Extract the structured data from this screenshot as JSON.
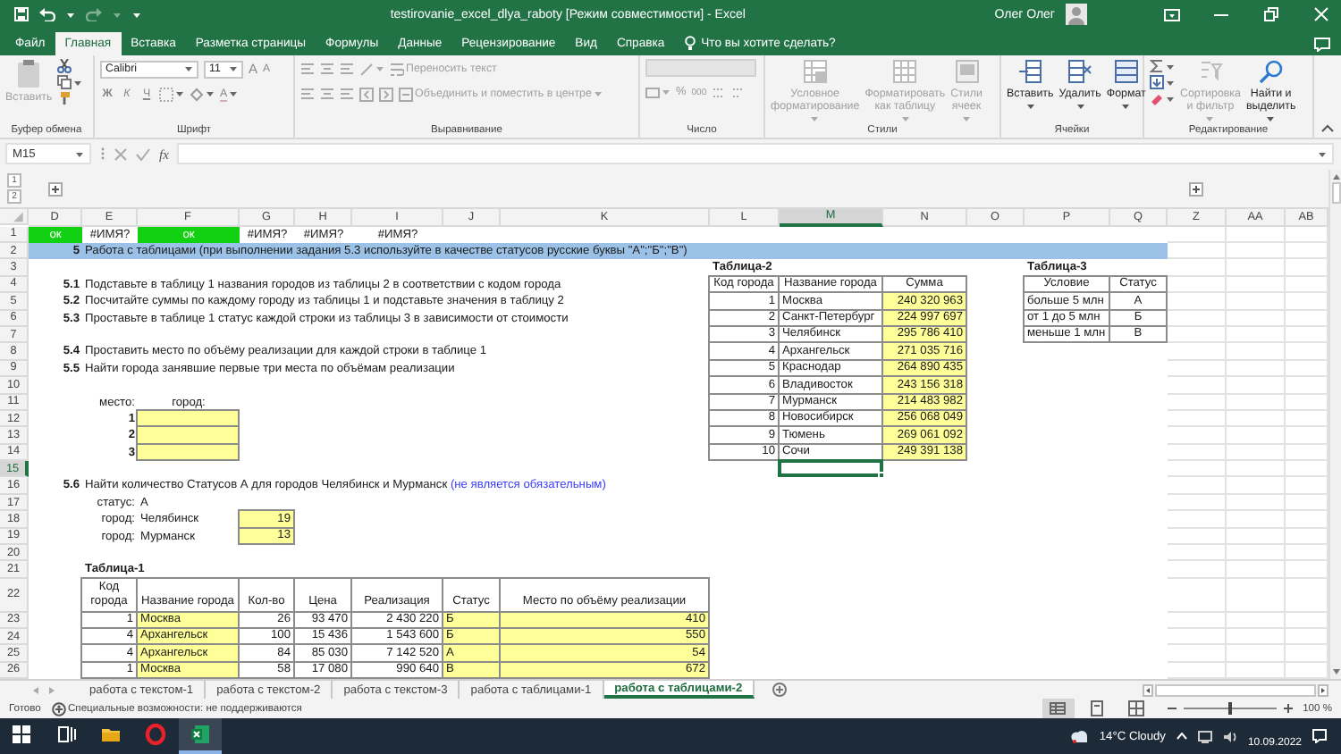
{
  "window": {
    "title": "testirovanie_excel_dlya_raboty [Режим совместимости] - Excel",
    "user": "Олег Олег",
    "quick_access": [
      {
        "kind": "save",
        "disabled": false
      },
      {
        "kind": "undo",
        "disabled": false
      },
      {
        "kind": "redo",
        "disabled": true
      }
    ]
  },
  "menu_tabs": [
    {
      "label": "Файл",
      "selected": false
    },
    {
      "label": "Главная",
      "selected": true
    },
    {
      "label": "Вставка",
      "selected": false
    },
    {
      "label": "Разметка страницы",
      "selected": false
    },
    {
      "label": "Формулы",
      "selected": false
    },
    {
      "label": "Данные",
      "selected": false
    },
    {
      "label": "Рецензирование",
      "selected": false
    },
    {
      "label": "Вид",
      "selected": false
    },
    {
      "label": "Справка",
      "selected": false
    }
  ],
  "tell_me": {
    "placeholder": "Что вы хотите сделать?"
  },
  "ribbon": {
    "clipboard": {
      "label": "Буфер обмена",
      "paste": "Вставить",
      "disabled": true
    },
    "font": {
      "label": "Шрифт",
      "name": "Calibri",
      "size": "11",
      "size_buttons": [
        "A",
        "A"
      ],
      "styles": [
        "Ж",
        "К",
        "Ч"
      ],
      "color_button": "A"
    },
    "alignment": {
      "label": "Выравнивание",
      "buttons": [
        {
          "label": "Переносить текст",
          "disabled": true
        },
        {
          "label": "Объединить и поместить в центре",
          "disabled": true
        }
      ]
    },
    "number": {
      "label": "Число",
      "symbols": [
        "%",
        "000"
      ]
    },
    "styles": {
      "label": "Стили",
      "buttons": [
        {
          "label": "Условное\nформатирование",
          "disabled": true
        },
        {
          "label": "Форматировать\nкак таблицу",
          "disabled": true
        },
        {
          "label": "Стили\nячеек",
          "disabled": true
        }
      ]
    },
    "cells": {
      "label": "Ячейки",
      "buttons": [
        {
          "label": "Вставить",
          "disabled": false
        },
        {
          "label": "Удалить",
          "disabled": false
        },
        {
          "label": "Формат",
          "disabled": false
        }
      ]
    },
    "editing": {
      "label": "Редактирование",
      "buttons": [
        {
          "label": "Сортировка\nи фильтр",
          "disabled": true
        },
        {
          "label": "Найти и\nвыделить",
          "disabled": false
        }
      ]
    }
  },
  "formula_bar": {
    "name_box": "M15",
    "function_label": "fx"
  },
  "outline": {
    "levels": [
      "1",
      "2"
    ],
    "groups": [
      {
        "expanded": false
      },
      {
        "expanded": false
      }
    ]
  },
  "sheet": {
    "columns": [
      {
        "label": "D",
        "selected": false
      },
      {
        "label": "E",
        "selected": false
      },
      {
        "label": "F",
        "selected": false
      },
      {
        "label": "G",
        "selected": false
      },
      {
        "label": "H",
        "selected": false
      },
      {
        "label": "I",
        "selected": false
      },
      {
        "label": "J",
        "selected": false
      },
      {
        "label": "K",
        "selected": false
      },
      {
        "label": "L",
        "selected": false
      },
      {
        "label": "M",
        "selected": true
      },
      {
        "label": "N",
        "selected": false
      },
      {
        "label": "O",
        "selected": false
      },
      {
        "label": "P",
        "selected": false
      },
      {
        "label": "Q",
        "selected": false
      },
      {
        "label": "Z",
        "selected": false
      },
      {
        "label": "AA",
        "selected": false
      },
      {
        "label": "AB",
        "selected": false
      }
    ],
    "rows": [
      {
        "label": "1",
        "selected": false,
        "tall": false,
        "cells": [
          {
            "kind": "ok",
            "text": "ок"
          },
          {
            "kind": "error",
            "text": "#ИМЯ?"
          },
          {
            "kind": "ok",
            "text": "ок"
          },
          {
            "kind": "error",
            "text": "#ИМЯ?"
          },
          {
            "kind": "error",
            "text": "#ИМЯ?"
          },
          {
            "kind": "error",
            "text": "#ИМЯ?"
          }
        ]
      },
      {
        "label": "2",
        "selected": false,
        "tall": false,
        "cells": [
          {
            "kind": "banner-number",
            "text": "5"
          },
          {
            "kind": "banner",
            "text": "Работа с таблицами (при выполнении задания 5.3 используйте в качестве статусов русские буквы \"А\";\"Б\";\"В\")"
          },
          {
            "kind": "banner"
          },
          {
            "kind": "banner"
          },
          {
            "kind": "banner"
          },
          {
            "kind": "banner"
          },
          {
            "kind": "banner"
          },
          {
            "kind": "banner"
          },
          {
            "kind": "banner"
          },
          {
            "kind": "banner"
          },
          {
            "kind": "banner"
          },
          {
            "kind": "banner"
          },
          {
            "kind": "banner"
          },
          {
            "kind": "banner"
          }
        ]
      },
      {
        "label": "3",
        "selected": false,
        "tall": false,
        "cells": [
          null,
          null,
          null,
          null,
          null,
          null,
          null,
          null,
          {
            "kind": "title",
            "text": "Таблица-2"
          },
          null,
          null,
          null,
          {
            "kind": "title",
            "text": "Таблица-3"
          }
        ]
      },
      {
        "label": "4",
        "selected": false,
        "tall": false,
        "cells": [
          {
            "kind": "task-number",
            "text": "5.1"
          },
          {
            "kind": "text",
            "text": "Подставьте в таблицу 1 названия городов из таблицы 2 в соответствии с кодом города"
          },
          null,
          null,
          null,
          null,
          null,
          null,
          {
            "kind": "header",
            "text": "Код города"
          },
          {
            "kind": "header",
            "text": "Название города"
          },
          {
            "kind": "header",
            "text": "Сумма"
          },
          null,
          {
            "kind": "header",
            "text": "Условие"
          },
          {
            "kind": "header",
            "text": "Статус"
          }
        ]
      },
      {
        "label": "5",
        "selected": false,
        "tall": false,
        "cells": [
          {
            "kind": "task-number",
            "text": "5.2"
          },
          {
            "kind": "text",
            "text": "Посчитайте суммы по каждому городу из таблицы 1 и подставьте значения в таблицу 2"
          },
          null,
          null,
          null,
          null,
          null,
          null,
          {
            "kind": "number",
            "text": "1"
          },
          {
            "kind": "name",
            "text": "Москва"
          },
          {
            "kind": "sum",
            "text": "240 320 963"
          },
          null,
          {
            "kind": "name",
            "text": "больше 5 млн"
          },
          {
            "kind": "center",
            "text": "А"
          }
        ]
      },
      {
        "label": "6",
        "selected": false,
        "tall": false,
        "cells": [
          {
            "kind": "task-number",
            "text": "5.3"
          },
          {
            "kind": "text",
            "text": "Проставьте в таблице 1 статус каждой строки из таблицы 3 в зависимости от стоимости"
          },
          null,
          null,
          null,
          null,
          null,
          null,
          {
            "kind": "number",
            "text": "2"
          },
          {
            "kind": "name",
            "text": "Санкт-Петербург"
          },
          {
            "kind": "sum",
            "text": "224 997 697"
          },
          null,
          {
            "kind": "name",
            "text": "от 1 до 5 млн"
          },
          {
            "kind": "center",
            "text": "Б"
          }
        ]
      },
      {
        "label": "7",
        "selected": false,
        "tall": false,
        "cells": [
          null,
          null,
          null,
          null,
          null,
          null,
          null,
          null,
          {
            "kind": "number",
            "text": "3"
          },
          {
            "kind": "name",
            "text": "Челябинск"
          },
          {
            "kind": "sum",
            "text": "295 786 410"
          },
          null,
          {
            "kind": "name",
            "text": "меньше 1 млн"
          },
          {
            "kind": "center",
            "text": "В"
          }
        ]
      },
      {
        "label": "8",
        "selected": false,
        "tall": false,
        "cells": [
          {
            "kind": "task-number",
            "text": "5.4"
          },
          {
            "kind": "text",
            "text": "Проставить место по объёму реализации для каждой строки в таблице 1"
          },
          null,
          null,
          null,
          null,
          null,
          null,
          {
            "kind": "number",
            "text": "4"
          },
          {
            "kind": "name",
            "text": "Архангельск"
          },
          {
            "kind": "sum",
            "text": "271 035 716"
          }
        ]
      },
      {
        "label": "9",
        "selected": false,
        "tall": false,
        "cells": [
          {
            "kind": "task-number",
            "text": "5.5"
          },
          {
            "kind": "text",
            "text": "Найти города занявшие первые три места по объёмам реализации"
          },
          null,
          null,
          null,
          null,
          null,
          null,
          {
            "kind": "number",
            "text": "5"
          },
          {
            "kind": "name",
            "text": "Краснодар"
          },
          {
            "kind": "sum",
            "text": "264 890 435"
          }
        ]
      },
      {
        "label": "10",
        "selected": false,
        "tall": false,
        "cells": [
          null,
          null,
          null,
          null,
          null,
          null,
          null,
          null,
          {
            "kind": "number",
            "text": "6"
          },
          {
            "kind": "name",
            "text": "Владивосток"
          },
          {
            "kind": "sum",
            "text": "243 156 318"
          }
        ]
      },
      {
        "label": "11",
        "selected": false,
        "tall": false,
        "cells": [
          null,
          {
            "kind": "label",
            "text": "место:"
          },
          {
            "kind": "caption",
            "text": "город:"
          },
          null,
          null,
          null,
          null,
          null,
          {
            "kind": "number",
            "text": "7"
          },
          {
            "kind": "name",
            "text": "Мурманск"
          },
          {
            "kind": "sum",
            "text": "214 483 982"
          }
        ]
      },
      {
        "label": "12",
        "selected": false,
        "tall": false,
        "cells": [
          null,
          {
            "kind": "place",
            "text": "1"
          },
          {
            "kind": "input"
          },
          null,
          null,
          null,
          null,
          null,
          {
            "kind": "number",
            "text": "8"
          },
          {
            "kind": "name",
            "text": "Новосибирск"
          },
          {
            "kind": "sum",
            "text": "256 068 049"
          }
        ]
      },
      {
        "label": "13",
        "selected": false,
        "tall": false,
        "cells": [
          null,
          {
            "kind": "place",
            "text": "2"
          },
          {
            "kind": "input"
          },
          null,
          null,
          null,
          null,
          null,
          {
            "kind": "number",
            "text": "9"
          },
          {
            "kind": "name",
            "text": "Тюмень"
          },
          {
            "kind": "sum",
            "text": "269 061 092"
          }
        ]
      },
      {
        "label": "14",
        "selected": false,
        "tall": false,
        "cells": [
          null,
          {
            "kind": "place",
            "text": "3"
          },
          {
            "kind": "input"
          },
          null,
          null,
          null,
          null,
          null,
          {
            "kind": "number",
            "text": "10"
          },
          {
            "kind": "name",
            "text": "Сочи"
          },
          {
            "kind": "sum",
            "text": "249 391 138"
          }
        ]
      },
      {
        "label": "15",
        "selected": true,
        "tall": false
      },
      {
        "label": "16",
        "selected": false,
        "tall": false,
        "cells": [
          {
            "kind": "task-number",
            "text": "5.6"
          },
          {
            "kind": "text",
            "text": "Найти количество Статусов А для городов Челябинск и Мурманск",
            "note": "(не является обязательным)"
          }
        ]
      },
      {
        "label": "17",
        "selected": false,
        "tall": false,
        "cells": [
          null,
          {
            "kind": "label",
            "text": "статус:"
          },
          {
            "kind": "text",
            "text": "А"
          }
        ]
      },
      {
        "label": "18",
        "selected": false,
        "tall": false,
        "cells": [
          null,
          {
            "kind": "label",
            "text": "город:"
          },
          {
            "kind": "text",
            "text": "Челябинск"
          },
          {
            "kind": "sum",
            "text": "19"
          }
        ]
      },
      {
        "label": "19",
        "selected": false,
        "tall": false,
        "cells": [
          null,
          {
            "kind": "label",
            "text": "город:"
          },
          {
            "kind": "text",
            "text": "Мурманск"
          },
          {
            "kind": "sum",
            "text": "13"
          }
        ]
      },
      {
        "label": "20",
        "selected": false,
        "tall": false
      },
      {
        "label": "21",
        "selected": false,
        "tall": false,
        "cells": [
          null,
          {
            "kind": "title",
            "text": "Таблица-1"
          }
        ]
      },
      {
        "label": "22",
        "selected": false,
        "tall": true,
        "cells": [
          null,
          {
            "kind": "header",
            "text": "Код города"
          },
          {
            "kind": "header",
            "text": "Название города"
          },
          {
            "kind": "header",
            "text": "Кол-во"
          },
          {
            "kind": "header",
            "text": "Цена"
          },
          {
            "kind": "header",
            "text": "Реализация"
          },
          {
            "kind": "header",
            "text": "Статус"
          },
          {
            "kind": "header",
            "text": "Место по объёму реализации"
          }
        ]
      },
      {
        "label": "23",
        "selected": false,
        "tall": false,
        "cells": [
          null,
          {
            "kind": "number",
            "text": "1"
          },
          {
            "kind": "name-input",
            "text": "Москва"
          },
          {
            "kind": "number",
            "text": "26"
          },
          {
            "kind": "number",
            "text": "93 470"
          },
          {
            "kind": "number",
            "text": "2 430 220"
          },
          {
            "kind": "name-input",
            "text": "Б"
          },
          {
            "kind": "sum",
            "text": "410"
          }
        ]
      },
      {
        "label": "24",
        "selected": false,
        "tall": false,
        "cells": [
          null,
          {
            "kind": "number",
            "text": "4"
          },
          {
            "kind": "name-input",
            "text": "Архангельск"
          },
          {
            "kind": "number",
            "text": "100"
          },
          {
            "kind": "number",
            "text": "15 436"
          },
          {
            "kind": "number",
            "text": "1 543 600"
          },
          {
            "kind": "name-input",
            "text": "Б"
          },
          {
            "kind": "sum",
            "text": "550"
          }
        ]
      },
      {
        "label": "25",
        "selected": false,
        "tall": false,
        "cells": [
          null,
          {
            "kind": "number",
            "text": "4"
          },
          {
            "kind": "name-input",
            "text": "Архангельск"
          },
          {
            "kind": "number",
            "text": "84"
          },
          {
            "kind": "number",
            "text": "85 030"
          },
          {
            "kind": "number",
            "text": "7 142 520"
          },
          {
            "kind": "name-input",
            "text": "А"
          },
          {
            "kind": "sum",
            "text": "54"
          }
        ]
      },
      {
        "label": "26",
        "selected": false,
        "tall": false,
        "cells": [
          null,
          {
            "kind": "number",
            "text": "1"
          },
          {
            "kind": "name-input",
            "text": "Москва"
          },
          {
            "kind": "number",
            "text": "58"
          },
          {
            "kind": "number",
            "text": "17 080"
          },
          {
            "kind": "number",
            "text": "990 640"
          },
          {
            "kind": "name-input",
            "text": "В"
          },
          {
            "kind": "sum",
            "text": "672"
          }
        ]
      }
    ]
  },
  "sheet_tabs": [
    {
      "label": "работа с текстом-1",
      "selected": false
    },
    {
      "label": "работа с текстом-2",
      "selected": false
    },
    {
      "label": "работа с текстом-3",
      "selected": false
    },
    {
      "label": "работа с таблицами-1",
      "selected": false
    },
    {
      "label": "работа с таблицами-2",
      "selected": true
    }
  ],
  "status_bar": {
    "mode": "Готово",
    "accessibility": "Специальные возможности: не поддерживаются",
    "views": [
      {
        "kind": "normal",
        "selected": true
      },
      {
        "kind": "page-layout",
        "selected": false
      },
      {
        "kind": "page-break",
        "selected": false
      }
    ],
    "zoom": {
      "level": 0.5,
      "reading": "100 %"
    }
  },
  "taskbar": {
    "apps": [
      {
        "kind": "start",
        "selected": false
      },
      {
        "kind": "task-view",
        "selected": false
      },
      {
        "kind": "explorer",
        "selected": false
      },
      {
        "kind": "browser",
        "selected": false
      },
      {
        "kind": "excel",
        "selected": true
      }
    ],
    "weather": "14°C Cloudy",
    "date": "10.09.2022"
  }
}
